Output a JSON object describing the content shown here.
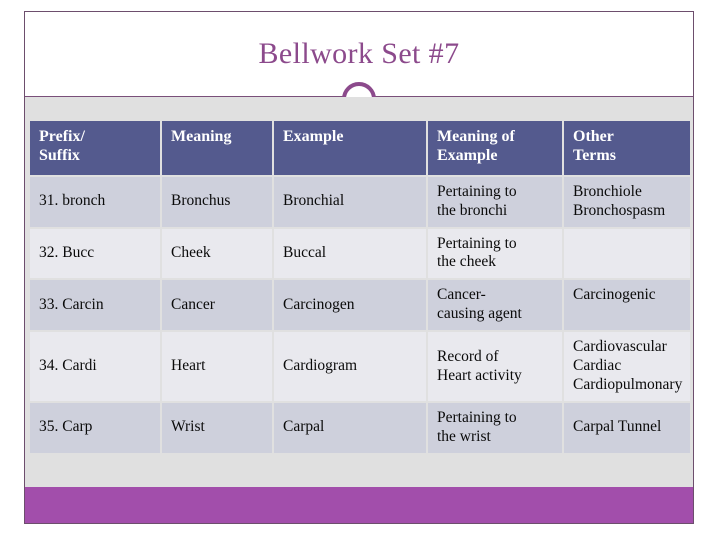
{
  "slide": {
    "title": "Bellwork Set #7",
    "accent_color": "#8c4a8c",
    "header_fill": "#545a8e",
    "bottom_bar_color": "#a24eab",
    "row_shade_color": "#ced0dc",
    "row_light_color": "#e9e9ee",
    "content_bg_color": "#e0e0e0",
    "decorations": {
      "ring": "circle-ring-decoration",
      "rule": "title-divider-rule"
    }
  },
  "table": {
    "columns": [
      "Prefix/\nSuffix",
      "Meaning",
      "Example",
      "Meaning of\nExample",
      "Other\nTerms"
    ],
    "columns_line1": [
      "Prefix/",
      "Meaning",
      "Example",
      "Meaning of",
      "Other"
    ],
    "columns_line2": [
      "Suffix",
      "",
      "",
      "Example",
      "Terms"
    ],
    "rows": [
      {
        "prefix_suffix": "31. bronch",
        "meaning": "Bronchus",
        "example": "Bronchial",
        "meaning_of_example": "Pertaining to the bronchi",
        "other_terms": "Bronchiole Bronchospasm",
        "other_terms_lines": [
          "Bronchiole",
          "Bronchospasm"
        ],
        "meaning_of_example_lines": [
          "Pertaining to",
          "the bronchi"
        ]
      },
      {
        "prefix_suffix": "32. Bucc",
        "meaning": "Cheek",
        "example": "Buccal",
        "meaning_of_example": "Pertaining to the cheek",
        "other_terms": "",
        "other_terms_lines": [],
        "meaning_of_example_lines": [
          "Pertaining to",
          "the cheek"
        ]
      },
      {
        "prefix_suffix": "33. Carcin",
        "meaning": "Cancer",
        "example": "Carcinogen",
        "meaning_of_example": "Cancer-causing agent",
        "other_terms": "Carcinogenic",
        "other_terms_lines": [
          "Carcinogenic"
        ],
        "meaning_of_example_lines": [
          "Cancer-",
          "causing agent"
        ]
      },
      {
        "prefix_suffix": "34. Cardi",
        "meaning": "Heart",
        "example": "Cardiogram",
        "meaning_of_example": "Record of Heart activity",
        "other_terms": "Cardiovascular Cardiac Cardiopulmonary",
        "other_terms_lines": [
          "Cardiovascular",
          "Cardiac",
          "Cardiopulmonary"
        ],
        "meaning_of_example_lines": [
          "Record of",
          "Heart activity"
        ]
      },
      {
        "prefix_suffix": "35. Carp",
        "meaning": "Wrist",
        "example": "Carpal",
        "meaning_of_example": "Pertaining to the wrist",
        "other_terms": "Carpal Tunnel",
        "other_terms_lines": [
          "Carpal Tunnel"
        ],
        "meaning_of_example_lines": [
          "Pertaining to",
          "the wrist"
        ]
      }
    ]
  }
}
